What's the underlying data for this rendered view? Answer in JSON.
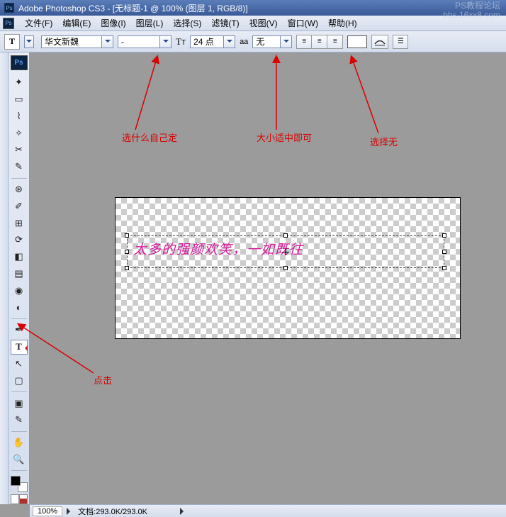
{
  "title": "Adobe Photoshop CS3 - [无标题-1 @ 100% (图层 1, RGB/8)]",
  "menu": {
    "file": "文件(F)",
    "edit": "编辑(E)",
    "image": "图像(I)",
    "layer": "图层(L)",
    "select": "选择(S)",
    "filter": "滤镜(T)",
    "view": "视图(V)",
    "window": "窗口(W)",
    "help": "帮助(H)"
  },
  "options": {
    "font_family": "华文新魏",
    "font_style": "-",
    "font_size": "24 点",
    "aa_label": "aa",
    "aa_mode": "无"
  },
  "canvas": {
    "sample_text": "太多的强颜欢笑，一如既往"
  },
  "annotations": {
    "font": "选什么自己定",
    "size": "大小适中即可",
    "aa": "选择无",
    "tool": "点击"
  },
  "status": {
    "zoom": "100%",
    "doc": "文档:293.0K/293.0K"
  },
  "watermark": {
    "l1": "PS教程论坛",
    "l2": "bbs.16xx8.com"
  }
}
